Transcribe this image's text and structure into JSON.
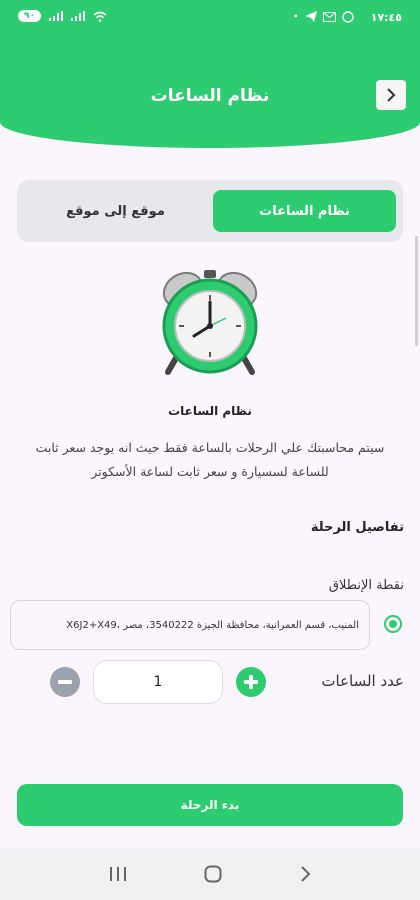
{
  "status_bar": {
    "time": "١٧:٤٥",
    "battery": "٩٠",
    "icons": [
      "battery-icon",
      "signal-icon",
      "signal-icon",
      "wifi-icon",
      "telegram-icon",
      "gmail-icon",
      "whatsapp-icon",
      "dot-icon"
    ]
  },
  "header": {
    "title": "نظام الساعات",
    "back_icon": "chevron-right-icon"
  },
  "tabs": [
    {
      "label": "نظام الساعات",
      "active": true
    },
    {
      "label": "موقع إلى موقع",
      "active": false
    }
  ],
  "illustration": {
    "icon": "alarm-clock-icon"
  },
  "section": {
    "heading": "نظام الساعات",
    "description_line1": "سيتم محاسبتك علي الرحلات بالساعة فقط حيث انه يوجد سعر ثابت",
    "description_line2": "للساعة لسسيارة و سعر ثابت لساعة الأسكوتر"
  },
  "trip": {
    "details_label": "تفاصيل الرحلة",
    "start_label": "نقطة الإنطلاق",
    "address": "المنيب، قسم العمرانية، محافظة الجيزة 3540222، مصر ،X6J2+X49",
    "hours_label": "عدد الساعات",
    "hours_value": "1"
  },
  "actions": {
    "start_trip": "بدء الرحلة"
  },
  "nav": {
    "icons": [
      "recent-apps-icon",
      "home-icon",
      "back-icon"
    ]
  },
  "colors": {
    "primary": "#2ecc71",
    "background": "#fbf5fd",
    "minus": "#9aa3ad"
  }
}
